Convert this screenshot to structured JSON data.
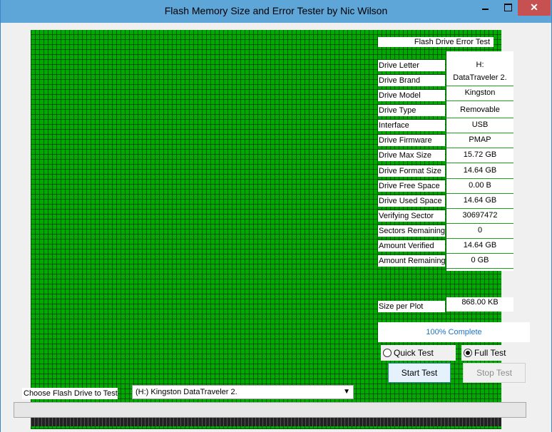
{
  "window": {
    "title": "Flash Memory Size and Error Tester by Nic Wilson"
  },
  "panel": {
    "header": "Flash Drive Error Test",
    "rows": [
      {
        "label": "Drive Letter",
        "value": "H:"
      },
      {
        "label": "Drive Brand",
        "value": "DataTraveler 2."
      },
      {
        "label": "Drive Model",
        "value": "Kingston"
      },
      {
        "label": "Drive Type",
        "value": "Removable"
      },
      {
        "label": "Interface",
        "value": "USB"
      },
      {
        "label": "Drive Firmware",
        "value": "PMAP"
      },
      {
        "label": "Drive Max Size",
        "value": "15.72 GB"
      },
      {
        "label": "Drive Format Size",
        "value": "14.64 GB"
      },
      {
        "label": "Drive Free Space",
        "value": "0.00 B"
      },
      {
        "label": "Drive Used Space",
        "value": "14.64 GB"
      },
      {
        "label": "Verifying Sector",
        "value": "30697472"
      },
      {
        "label": "Sectors Remaining",
        "value": "0"
      },
      {
        "label": "Amount Verified",
        "value": "14.64 GB"
      },
      {
        "label": "Amount Remaining",
        "value": "0 GB"
      }
    ],
    "size_per_plot": {
      "label": "Size per Plot",
      "value": "868.00 KB"
    },
    "progress_text": "100% Complete"
  },
  "test_mode": {
    "quick": "Quick Test",
    "full": "Full Test",
    "selected": "full"
  },
  "buttons": {
    "start": "Start Test",
    "stop": "Stop Test"
  },
  "drive_chooser": {
    "label": "Choose Flash Drive to Test",
    "selected": "(H:) Kingston DataTraveler 2."
  },
  "colors": {
    "grid": "#00aa00",
    "titlebar": "#5ea5d8",
    "close": "#c75050",
    "progress_text": "#1a73c9"
  }
}
